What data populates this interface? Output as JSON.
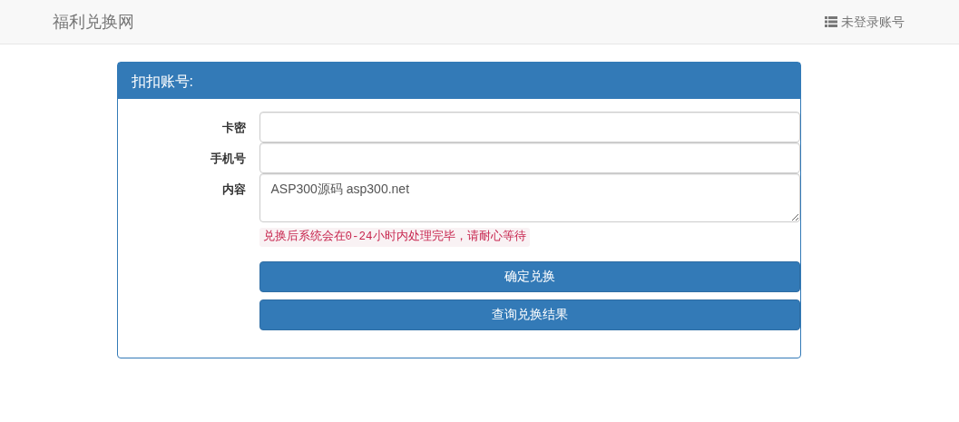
{
  "navbar": {
    "brand": "福利兑换网",
    "account_link": "未登录账号"
  },
  "panel": {
    "title": "扣扣账号:",
    "fields": [
      {
        "label": "卡密",
        "kind": "input"
      },
      {
        "label": "手机号",
        "kind": "input"
      },
      {
        "label": "内容",
        "kind": "textarea",
        "value": "ASP300源码 asp300.net"
      }
    ],
    "hint": "兑换后系统会在0-24小时内处理完毕，请耐心等待",
    "buttons": [
      "确定兑换",
      "查询兑换结果"
    ]
  }
}
